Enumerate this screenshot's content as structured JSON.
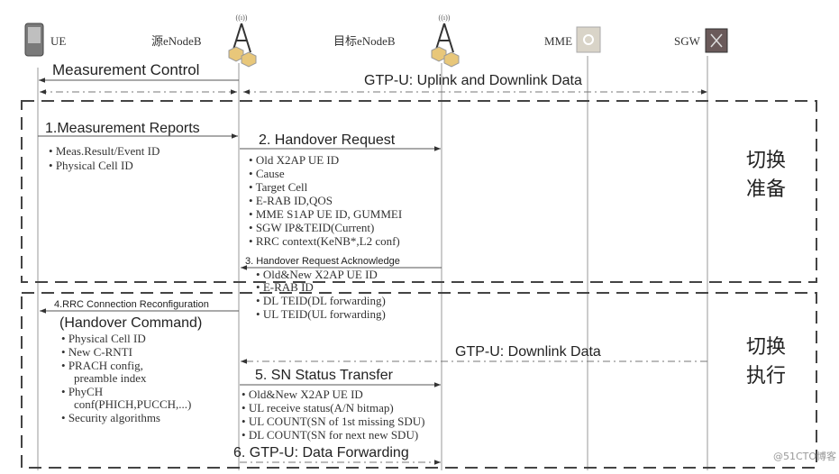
{
  "entities": {
    "ue": "UE",
    "source_enb": "源eNodeB",
    "target_enb": "目标eNodeB",
    "mme": "MME",
    "sgw": "SGW"
  },
  "messages": {
    "measurement_control": "Measurement Control",
    "gtp_uplink_downlink": "GTP-U: Uplink and Downlink Data",
    "measurement_reports": "1.Measurement Reports",
    "handover_request": "2. Handover Request",
    "handover_ack": "3. Handover Request Acknowledge",
    "rrc_reconfig": "4.RRC Connection Reconfiguration",
    "handover_command": "(Handover Command)",
    "gtp_downlink": "GTP-U: Downlink Data",
    "sn_status": "5. SN Status Transfer",
    "data_forwarding": "6. GTP-U: Data Forwarding"
  },
  "params": {
    "measurement_reports": [
      "Meas.Result/Event ID",
      "Physical Cell ID"
    ],
    "handover_request": [
      "Old X2AP UE ID",
      "Cause",
      "Target Cell",
      "E-RAB ID,QOS",
      "MME S1AP UE ID, GUMMEI",
      "SGW IP&TEID(Current)",
      "RRC context(KeNB*,L2 conf)"
    ],
    "handover_ack": [
      "Old&New X2AP UE ID",
      "E-RAB ID",
      "DL TEID(DL forwarding)",
      "UL TEID(UL forwarding)"
    ],
    "rrc_reconfig": [
      "Physical Cell ID",
      "New C-RNTI",
      "PRACH config,",
      "preamble index",
      "PhyCH",
      "conf(PHICH,PUCCH,...)",
      "Security algorithms"
    ],
    "sn_status": [
      "Old&New X2AP UE ID",
      "UL receive status(A/N bitmap)",
      "UL COUNT(SN of 1st missing SDU)",
      "DL COUNT(SN for next new SDU)"
    ]
  },
  "phases": {
    "prep_line1": "切换",
    "prep_line2": "准备",
    "exec_line1": "切换",
    "exec_line2": "执行"
  },
  "watermark": "@51CTO博客"
}
